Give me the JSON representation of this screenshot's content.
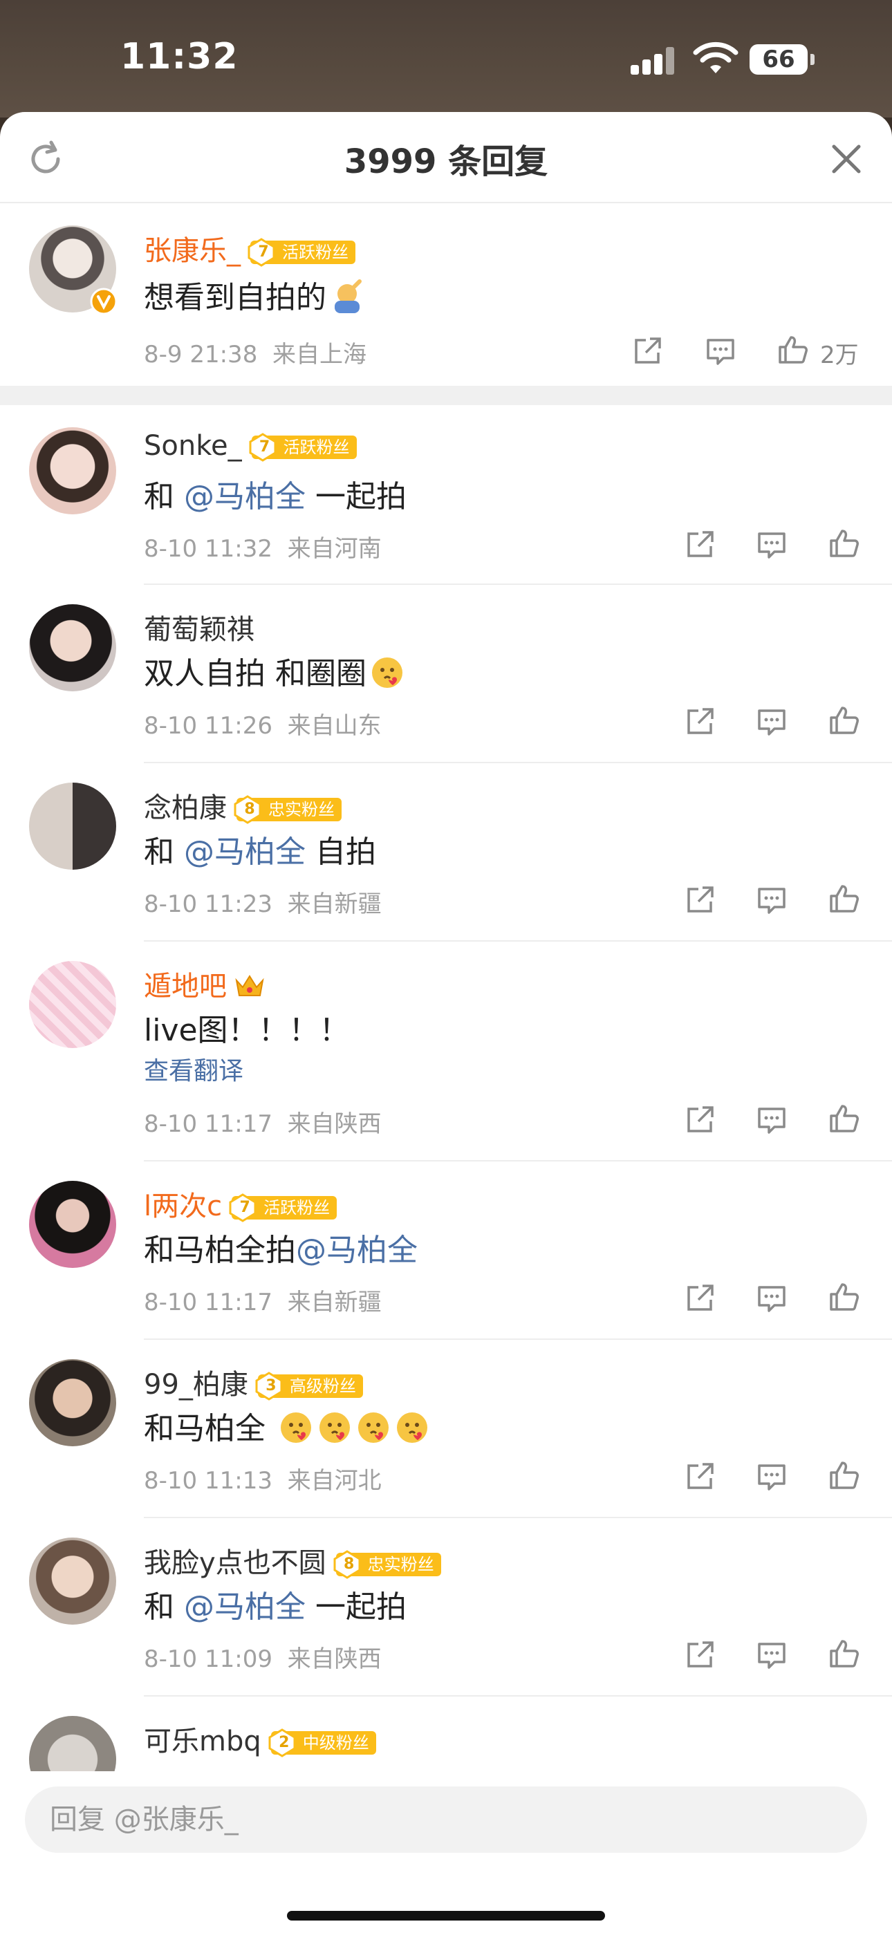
{
  "status_bar": {
    "time": "11:32",
    "battery": "66"
  },
  "header": {
    "title": "3999 条回复"
  },
  "main_comment": {
    "username": "张康乐_",
    "badge_level": "7",
    "badge_text": "活跃粉丝",
    "text": "想看到自拍的",
    "timestamp": "8-9 21:38",
    "location": "来自上海",
    "like_count": "2万"
  },
  "replies": [
    {
      "username": "Sonke_",
      "badge_level": "7",
      "badge_text": "活跃粉丝",
      "text_before": "和 ",
      "mention": "@马柏全",
      "text_after": " 一起拍",
      "timestamp": "8-10 11:32",
      "location": "来自河南"
    },
    {
      "username": "葡萄颖祺",
      "text_before": "双人自拍 和圈圈",
      "timestamp": "8-10 11:26",
      "location": "来自山东"
    },
    {
      "username": "念柏康",
      "badge_level": "8",
      "badge_text": "忠实粉丝",
      "text_before": "和 ",
      "mention": "@马柏全",
      "text_after": " 自拍",
      "timestamp": "8-10 11:23",
      "location": "来自新疆"
    },
    {
      "username": "遁地吧",
      "text_before": "live图！！！！",
      "translate": "查看翻译",
      "timestamp": "8-10 11:17",
      "location": "来自陕西"
    },
    {
      "username": "l两次c",
      "badge_level": "7",
      "badge_text": "活跃粉丝",
      "text_before": "和马柏全拍",
      "mention": "@马柏全",
      "timestamp": "8-10 11:17",
      "location": "来自新疆"
    },
    {
      "username": "99_柏康",
      "badge_level": "3",
      "badge_text": "高级粉丝",
      "text_before": "和马柏全",
      "timestamp": "8-10 11:13",
      "location": "来自河北"
    },
    {
      "username": "我脸y点也不圆",
      "badge_level": "8",
      "badge_text": "忠实粉丝",
      "text_before": "和 ",
      "mention": "@马柏全",
      "text_after": " 一起拍",
      "timestamp": "8-10 11:09",
      "location": "来自陕西"
    },
    {
      "username": "可乐mbq",
      "badge_level": "2",
      "badge_text": "中级粉丝"
    }
  ],
  "reply_input": {
    "placeholder": "回复 @张康乐_"
  },
  "colors": {
    "accent_orange": "#f26a1c",
    "mention_blue": "#4a6fa5",
    "badge_gold": "#fbbd19"
  },
  "icons": [
    "refresh-icon",
    "close-icon",
    "share-icon",
    "comment-icon",
    "like-icon",
    "verified-icon",
    "crown-icon",
    "emoji-icon"
  ]
}
